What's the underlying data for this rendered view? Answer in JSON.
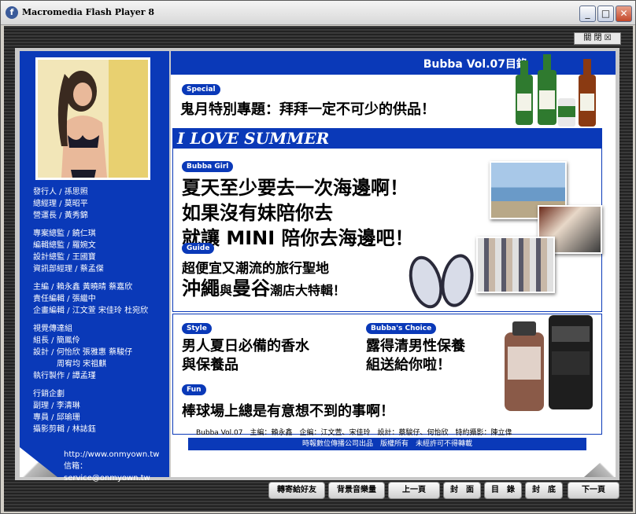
{
  "window": {
    "title": "Macromedia Flash Player 8",
    "app_icon": "f"
  },
  "controls": {
    "minimize": "_",
    "maximize": "□",
    "close": "✕"
  },
  "close_box": "關 閉 ☒",
  "staff": [
    [
      "發行人 / 孫思照",
      "總經理 / 莫昭平",
      "營運長 / 黃秀錦"
    ],
    [
      "專案總監 / 饒仁琪",
      "編輯總監 / 羅婉文",
      "設計總監 / 王國寶",
      "資訊部經理 / 蔡孟傑"
    ],
    [
      "主編 / 賴永鑫 黃曉晴 蔡嘉欣",
      "責任編輯 / 張繼中",
      "企畫編輯 / 江文萱 宋佳玲 杜宛欣"
    ],
    [
      "視覺傳達組",
      "組長 / 簡鳳伶",
      "設計 / 何怡欣 張雅惠 蔡駿仔",
      "　　　周宥均 宋祖麒",
      "執行製作 / 譚孟瑾"
    ],
    [
      "行銷企劃",
      "副理 / 李清琳",
      "專員 / 邱瑜珊",
      "攝影剪輯 / 林誌鈺"
    ]
  ],
  "urls": {
    "web": "http://www.onmyown.tw",
    "mail": "信箱：service@onmyown.tw"
  },
  "header": "Bubba Vol.07目錄",
  "special": {
    "tag": "Special",
    "headline": "鬼月特別專題：拜拜一定不可少的供品！"
  },
  "summer_title": "I LOVE SUMMER",
  "girl": {
    "tag": "Bubba Girl",
    "lines": [
      "夏天至少要去一次海邊啊！",
      "如果沒有妹陪你去",
      "就讓 MINI 陪你去海邊吧！"
    ]
  },
  "guide": {
    "tag": "Guide",
    "line1": "超便宜又潮流的旅行聖地",
    "line2a": "沖繩",
    "line2b": "與",
    "line2c": "曼谷",
    "line2d": "潮店大特輯！"
  },
  "style": {
    "tag": "Style",
    "lines": [
      "男人夏日必備的香水",
      "與保養品"
    ]
  },
  "choice": {
    "tag": "Bubba's Choice",
    "lines": [
      "露得清男性保養",
      "組送給你啦！"
    ]
  },
  "fun": {
    "tag": "Fun",
    "headline": "棒球場上總是有意想不到的事啊！"
  },
  "credit": "Bubba Vol.07　主編：賴永鑫　企編：江文萱、宋佳玲　設計：蔡駿仔、何怡欣　特約攝影：陳立偉",
  "footer": "時報數位傳播公司出品　版權所有　未經許可不得轉載",
  "nav": [
    "轉寄給好友",
    "背景音樂量",
    "上一頁",
    "封　面",
    "目　錄",
    "封　底",
    "下一頁"
  ]
}
